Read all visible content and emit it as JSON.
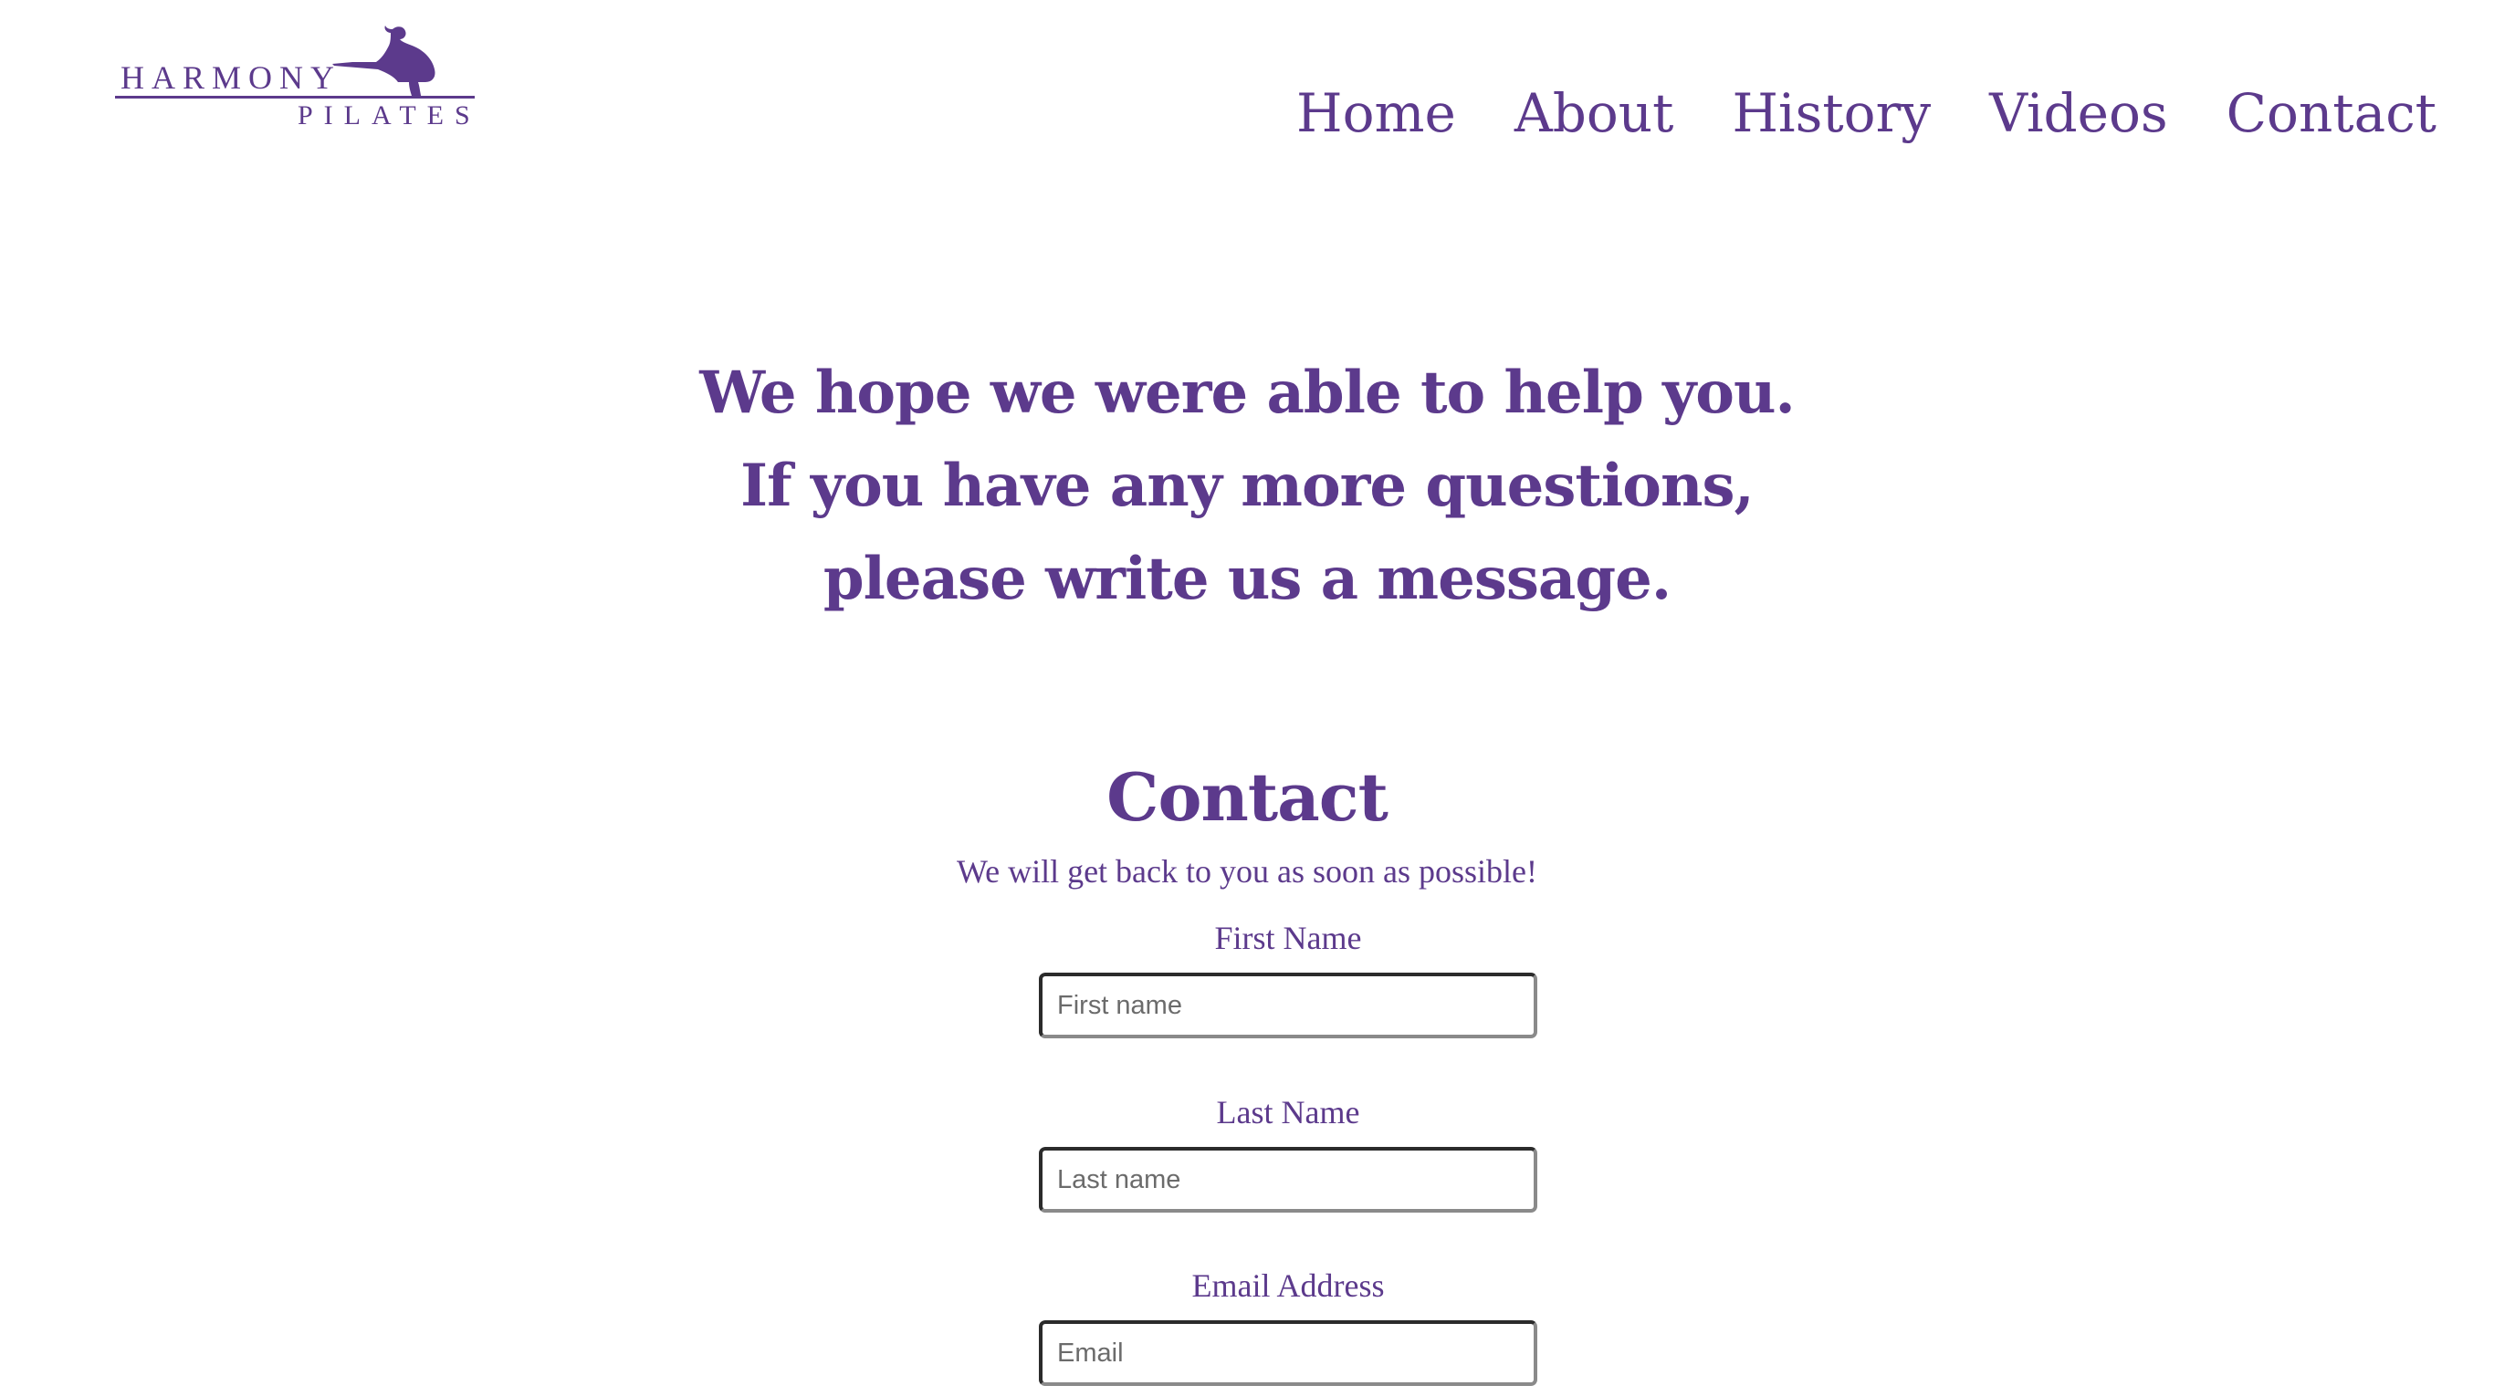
{
  "brand": {
    "word1": "HARMONY",
    "word2": "PILATES",
    "color": "#5c3a8c"
  },
  "nav": {
    "items": [
      "Home",
      "About",
      "History",
      "Videos",
      "Contact"
    ]
  },
  "intro": {
    "lines": [
      "We hope we were able to help you.",
      "If you have any more questions,",
      "please write us a message."
    ]
  },
  "contact": {
    "title": "Contact",
    "subtitle": "We will get back to you as soon as possible!",
    "fields": [
      {
        "label": "First Name",
        "placeholder": "First name"
      },
      {
        "label": "Last Name",
        "placeholder": "Last name"
      },
      {
        "label": "Email Address",
        "placeholder": "Email"
      }
    ]
  }
}
